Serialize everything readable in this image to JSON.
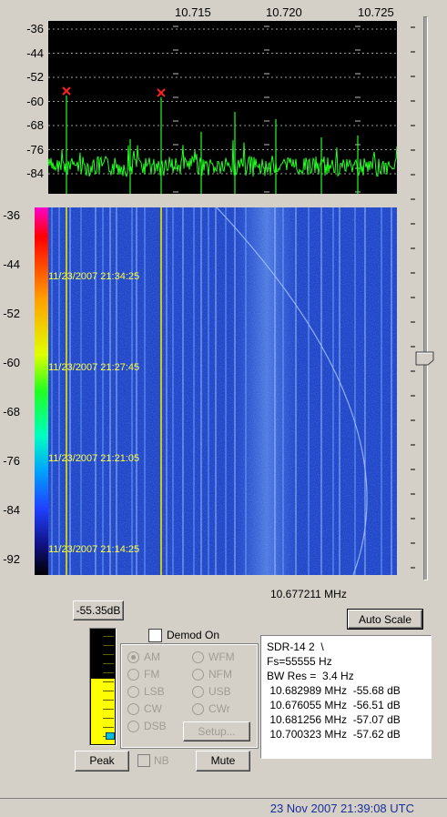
{
  "spectrum": {
    "freq_ticks": [
      "10.715",
      "10.720",
      "10.725"
    ],
    "db_ticks": [
      "-36",
      "-44",
      "-52",
      "-60",
      "-68",
      "-76",
      "-84"
    ],
    "trace_color": "#22ff22",
    "marker_color": "#ff2020"
  },
  "waterfall": {
    "db_ticks": [
      "-36",
      "-44",
      "-52",
      "-60",
      "-68",
      "-76",
      "-84",
      "-92"
    ],
    "timestamps": [
      "11/23/2007 21:34:25",
      "11/23/2007 21:27:45",
      "11/23/2007 21:21:05",
      "11/23/2007 21:14:25"
    ],
    "center_freq": "10.677211 MHz",
    "background_color": "#1e44c8"
  },
  "controls": {
    "level_label": "-55.35dB",
    "level_fraction": 0.57,
    "demod_label": "Demod On",
    "demod_checked": false,
    "modes": [
      {
        "label": "AM",
        "selected": true
      },
      {
        "label": "WFM",
        "selected": false
      },
      {
        "label": "FM",
        "selected": false
      },
      {
        "label": "NFM",
        "selected": false
      },
      {
        "label": "LSB",
        "selected": false
      },
      {
        "label": "USB",
        "selected": false
      },
      {
        "label": "CW",
        "selected": false
      },
      {
        "label": "CWr",
        "selected": false
      },
      {
        "label": "DSB",
        "selected": false
      }
    ],
    "setup_label": "Setup...",
    "peak_label": "Peak",
    "nb_label": "NB",
    "mute_label": "Mute",
    "auto_scale_label": "Auto Scale"
  },
  "info": {
    "lines": [
      "SDR-14 2  \\",
      "Fs=55555 Hz",
      "BW Res =  3.4 Hz",
      " 10.682989 MHz  -55.68 dB",
      " 10.676055 MHz  -56.51 dB",
      " 10.681256 MHz  -57.07 dB",
      " 10.700323 MHz  -57.62 dB"
    ]
  },
  "status": {
    "datetime": "23 Nov 2007  21:39:08 UTC"
  }
}
